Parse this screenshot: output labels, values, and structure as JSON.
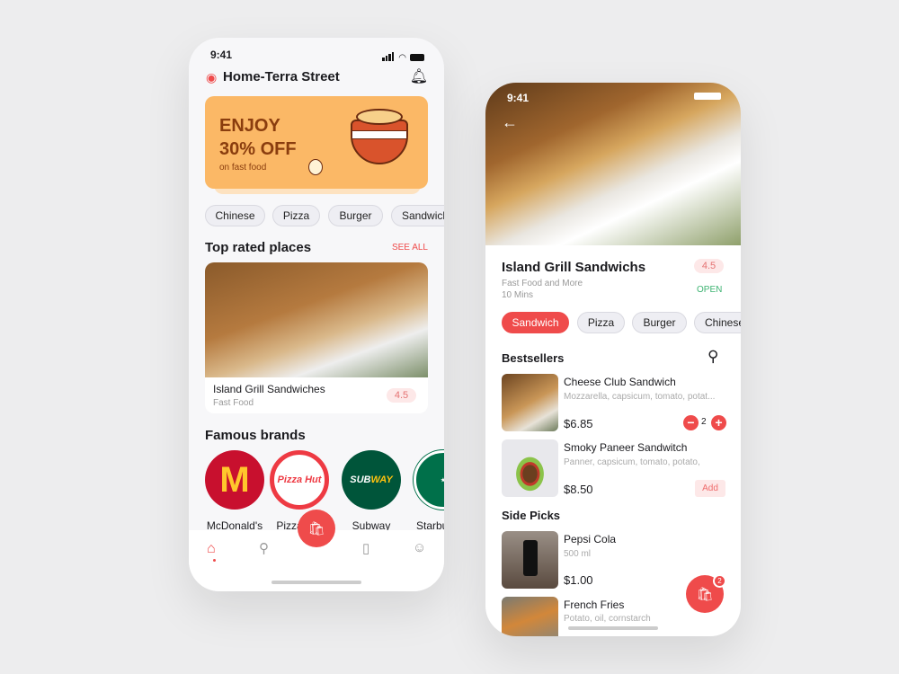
{
  "colors": {
    "accent": "#ef4b4b",
    "banner": "#fbb866",
    "banner_text": "#8a3d0e",
    "open": "#3cb371",
    "background": "#ededee"
  },
  "home": {
    "time": "9:41",
    "location": "Home-Terra Street",
    "banner": {
      "line1": "ENJOY",
      "line2": "30% OFF",
      "line3": "on fast food"
    },
    "categories": [
      "Chinese",
      "Pizza",
      "Burger",
      "Sandwich"
    ],
    "top_rated": {
      "title": "Top rated places",
      "see_all": "SEE ALL",
      "place": {
        "name": "Island Grill Sandwiches",
        "type": "Fast Food",
        "rating": "4.5"
      }
    },
    "brands": {
      "title": "Famous brands",
      "items": [
        {
          "name": "McDonald's",
          "logo": "M",
          "color": "#c8102e"
        },
        {
          "name": "Pizza Hut",
          "logo": "Pizza Hut",
          "color": "#ee3a43"
        },
        {
          "name": "Subway",
          "logo": "SUBWAY",
          "color": "#00553a"
        },
        {
          "name": "Starbucks",
          "logo": "STARBUCKS COFFEE",
          "color": "#00704a"
        }
      ]
    },
    "nav": [
      "home-icon",
      "search-icon",
      "cart-icon",
      "bookmark-icon",
      "profile-icon"
    ]
  },
  "restaurant": {
    "time": "9:41",
    "name": "Island Grill Sandwichs",
    "subtitle": "Fast Food and More",
    "eta": "10 Mins",
    "rating": "4.5",
    "status": "OPEN",
    "categories": [
      {
        "label": "Sandwich",
        "active": true
      },
      {
        "label": "Pizza"
      },
      {
        "label": "Burger"
      },
      {
        "label": "Chinese"
      }
    ],
    "bestsellers": {
      "title": "Bestsellers",
      "items": [
        {
          "name": "Cheese Club Sandwich",
          "desc": "Mozzarella, capsicum, tomato, potat...",
          "price": "$6.85",
          "qty": "2"
        },
        {
          "name": "Smoky Paneer Sandwitch",
          "desc": "Panner, capsicum, tomato, potato,",
          "price": "$8.50",
          "action": "Add"
        }
      ]
    },
    "side_picks": {
      "title": "Side Picks",
      "items": [
        {
          "name": "Pepsi Cola",
          "desc": "500 ml",
          "price": "$1.00"
        },
        {
          "name": "French Fries",
          "desc": "Potato, oil, cornstarch"
        }
      ]
    },
    "cart_count": "2"
  }
}
